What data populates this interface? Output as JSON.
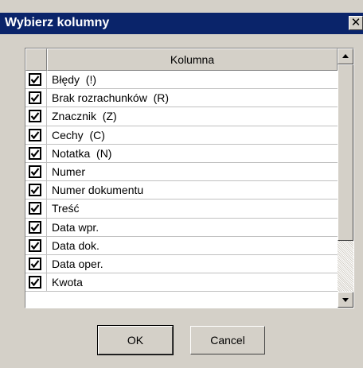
{
  "dialog": {
    "title": "Wybierz kolumny",
    "close_glyph": "✕"
  },
  "list": {
    "header": "Kolumna",
    "rows": [
      {
        "label": "Błędy  (!)",
        "checked": true
      },
      {
        "label": "Brak rozrachunków  (R)",
        "checked": true
      },
      {
        "label": "Znacznik  (Z)",
        "checked": true
      },
      {
        "label": "Cechy  (C)",
        "checked": true
      },
      {
        "label": "Notatka  (N)",
        "checked": true
      },
      {
        "label": "Numer",
        "checked": true
      },
      {
        "label": "Numer dokumentu",
        "checked": true
      },
      {
        "label": "Treść",
        "checked": true
      },
      {
        "label": "Data wpr.",
        "checked": true
      },
      {
        "label": "Data dok.",
        "checked": true
      },
      {
        "label": "Data oper.",
        "checked": true
      },
      {
        "label": "Kwota",
        "checked": true
      }
    ]
  },
  "buttons": {
    "ok": "OK",
    "cancel": "Cancel"
  },
  "colors": {
    "titlebar": "#0a246a",
    "face": "#d4d0c8"
  }
}
